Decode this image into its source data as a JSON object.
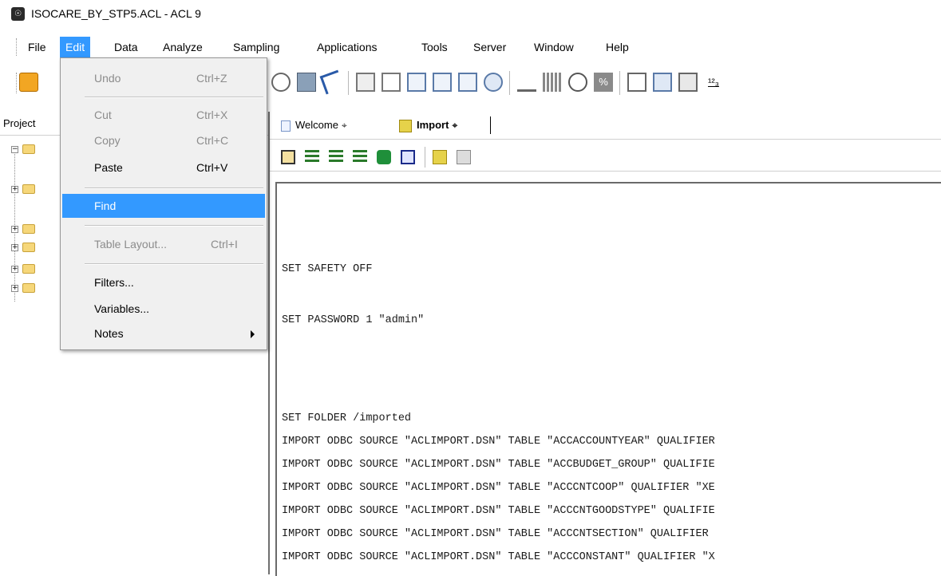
{
  "window": {
    "title": "ISOCARE_BY_STP5.ACL - ACL 9"
  },
  "menubar": {
    "items": [
      "File",
      "Edit",
      "Data",
      "Analyze",
      "Sampling",
      "Applications",
      "Tools",
      "Server",
      "Window",
      "Help"
    ]
  },
  "edit_menu": {
    "undo": {
      "label": "Undo",
      "shortcut": "Ctrl+Z"
    },
    "cut": {
      "label": "Cut",
      "shortcut": "Ctrl+X"
    },
    "copy": {
      "label": "Copy",
      "shortcut": "Ctrl+C"
    },
    "paste": {
      "label": "Paste",
      "shortcut": "Ctrl+V"
    },
    "find": {
      "label": "Find"
    },
    "table_layout": {
      "label": "Table Layout...",
      "shortcut": "Ctrl+I"
    },
    "filters": {
      "label": "Filters..."
    },
    "variables": {
      "label": "Variables..."
    },
    "notes": {
      "label": "Notes"
    }
  },
  "project_pane": {
    "header": "Project"
  },
  "tabs": [
    {
      "label": "Welcome"
    },
    {
      "label": "Import"
    }
  ],
  "script": {
    "lines": [
      "SET SAFETY OFF",
      "SET PASSWORD 1 \"admin\"",
      "SET FOLDER /imported",
      "IMPORT ODBC SOURCE \"ACLIMPORT.DSN\" TABLE \"ACCACCOUNTYEAR\" QUALIFIER",
      "IMPORT ODBC SOURCE \"ACLIMPORT.DSN\" TABLE \"ACCBUDGET_GROUP\" QUALIFIE",
      "IMPORT ODBC SOURCE \"ACLIMPORT.DSN\" TABLE \"ACCCNTCOOP\" QUALIFIER \"XE",
      "IMPORT ODBC SOURCE \"ACLIMPORT.DSN\" TABLE \"ACCCNTGOODSTYPE\" QUALIFIE",
      "IMPORT ODBC SOURCE \"ACLIMPORT.DSN\" TABLE \"ACCCNTSECTION\" QUALIFIER ",
      "IMPORT ODBC SOURCE \"ACLIMPORT.DSN\" TABLE \"ACCCONSTANT\" QUALIFIER \"X"
    ]
  },
  "colors": {
    "highlight": "#3399ff",
    "menu_bg": "#f0f0f0"
  }
}
